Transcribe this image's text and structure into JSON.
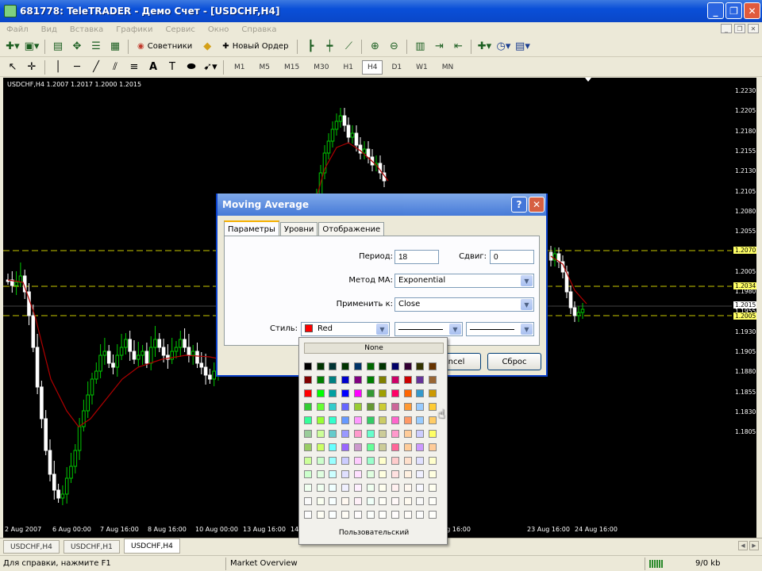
{
  "window": {
    "title": "681778: TeleTRADER - Демо Счет - [USDCHF,H4]",
    "buttons": [
      "_",
      "❐",
      "✕"
    ]
  },
  "menu": [
    "Файл",
    "Вид",
    "Вставка",
    "Графики",
    "Сервис",
    "Окно",
    "Справка"
  ],
  "toolbar": {
    "advisors_label": "Советники",
    "new_order_label": "Новый Ордер"
  },
  "drawing_tools": {
    "text_tool": "A"
  },
  "timeframes": [
    "M1",
    "M5",
    "M15",
    "M30",
    "H1",
    "H4",
    "D1",
    "W1",
    "MN"
  ],
  "active_timeframe": "H4",
  "chart": {
    "label": "USDCHF,H4  1.2007 1.2017 1.2000 1.2015",
    "price_labels": [
      "1.2230",
      "1.2205",
      "1.2180",
      "1.2155",
      "1.2130",
      "1.2105",
      "1.2080",
      "1.2055",
      "1.2030",
      "1.2005",
      "1.1980",
      "1.1955",
      "1.1930",
      "1.1905",
      "1.1880",
      "1.1855",
      "1.1830",
      "1.1805"
    ],
    "price_badges": [
      "1.2070",
      "1.2034",
      "1.2015",
      "1.2005"
    ],
    "time_labels": [
      "2 Aug 2007",
      "6 Aug 00:00",
      "7 Aug 16:00",
      "8 Aug 16:00",
      "10 Aug 00:00",
      "13 Aug 16:00",
      "14",
      "22 Aug 16:00",
      "23 Aug 16:00",
      "24 Aug 16:00"
    ],
    "colors": {
      "bull": "#00c800",
      "bear": "#ffffff",
      "ma": "#b00000",
      "level": "#c8c800"
    }
  },
  "chart_tabs": [
    "USDCHF,H4",
    "USDCHF,H1",
    "USDCHF,H4"
  ],
  "active_chart_tab": 2,
  "status": {
    "help": "Для справки, нажмите F1",
    "market": "Market Overview",
    "traffic": "9/0 kb"
  },
  "dialog": {
    "title": "Moving Average",
    "help_btn": "?",
    "close_btn": "✕",
    "tabs": [
      "Параметры",
      "Уровни",
      "Отображение"
    ],
    "period_label": "Период:",
    "period_value": "18",
    "shift_label": "Сдвиг:",
    "shift_value": "0",
    "method_label": "Метод МА:",
    "method_value": "Exponential",
    "apply_label": "Применить к:",
    "apply_value": "Close",
    "style_label": "Стиль:",
    "style_color": "Red",
    "cancel_label": "ncel",
    "reset_label": "Сброс"
  },
  "color_picker": {
    "none_label": "None",
    "custom_label": "Пользовательский",
    "colors": [
      "#000000",
      "#003300",
      "#003333",
      "#003300",
      "#003366",
      "#006600",
      "#003300",
      "#000066",
      "#330033",
      "#333300",
      "#663300",
      "#800000",
      "#008000",
      "#008080",
      "#0000cc",
      "#800080",
      "#008000",
      "#808000",
      "#cc0066",
      "#cc0000",
      "#663399",
      "#996633",
      "#ff0000",
      "#00ff00",
      "#00a0a0",
      "#0000ff",
      "#ff00ff",
      "#339933",
      "#a0a000",
      "#ff0066",
      "#ff6600",
      "#3399cc",
      "#cc9900",
      "#33cc33",
      "#66ff33",
      "#33cccc",
      "#6666ff",
      "#99cc33",
      "#669933",
      "#cccc33",
      "#cc6699",
      "#ff9933",
      "#99ccff",
      "#ffcc33",
      "#33ff99",
      "#99ff33",
      "#33ffcc",
      "#6699ff",
      "#ff99ff",
      "#33cc66",
      "#cccc66",
      "#ff66cc",
      "#ff9966",
      "#99ccff",
      "#ffcc66",
      "#99cc99",
      "#ccff99",
      "#66cccc",
      "#9999ff",
      "#ff99cc",
      "#66ffcc",
      "#cccc99",
      "#ff99cc",
      "#ffcc99",
      "#ccccff",
      "#ffff66",
      "#99cc66",
      "#ccff66",
      "#66ffff",
      "#9966ff",
      "#cc99cc",
      "#66ff99",
      "#cccc99",
      "#ff6699",
      "#ffcc99",
      "#cc99ff",
      "#ffcc99",
      "#ccff99",
      "#ccffcc",
      "#99ffff",
      "#ccccff",
      "#ffccff",
      "#99ffcc",
      "#ffffcc",
      "#ffcccc",
      "#ffe0cc",
      "#e0e0ff",
      "#ffffcc",
      "#ccffcc",
      "#e0ffe0",
      "#ccffff",
      "#e0e0ff",
      "#ffe0ff",
      "#e0ffe0",
      "#ffffe0",
      "#ffe0e0",
      "#fff0e0",
      "#f0f0ff",
      "#ffffe0",
      "#f0fff0",
      "#f0fff0",
      "#f0ffff",
      "#f0f0ff",
      "#fff0ff",
      "#f0fff0",
      "#fffff0",
      "#fff0f0",
      "#fff8f0",
      "#f8f8ff",
      "#fffff0",
      "#fafafa",
      "#fafff0",
      "#f8ffff",
      "#fff8f0",
      "#fff0f8",
      "#f0fff8",
      "#fffff8",
      "#fff8f8",
      "#fffaf0",
      "#f8f8f8",
      "#fffffa",
      "#fcfcfc",
      "#fffff5",
      "#fcffff",
      "#fffcf5",
      "#fffcfc",
      "#fcfffc",
      "#fffffc",
      "#fffcfc",
      "#fffcf8",
      "#fcfcfc",
      "#fffffc"
    ]
  }
}
